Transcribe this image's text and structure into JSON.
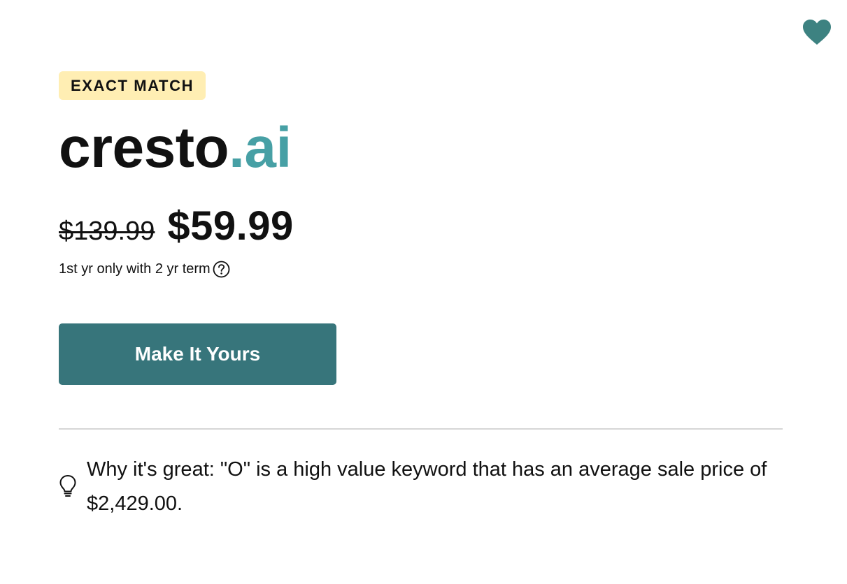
{
  "badge": {
    "label": "EXACT MATCH"
  },
  "domain": {
    "name": "cresto",
    "tld": ".ai"
  },
  "pricing": {
    "old_price": "$139.99",
    "new_price": "$59.99",
    "term_note": "1st yr only with 2 yr term"
  },
  "cta": {
    "label": "Make It Yours"
  },
  "tip": {
    "text": "Why it's great: \"O\" is a high value keyword that has an average sale price of $2,429.00."
  },
  "icons": {
    "favorite": "heart-icon",
    "help": "question-circle-icon",
    "tip": "lightbulb-icon"
  },
  "colors": {
    "accent": "#37757b",
    "tld": "#47a0a5",
    "badge_bg": "#ffeeb3",
    "heart": "#3d8281"
  }
}
